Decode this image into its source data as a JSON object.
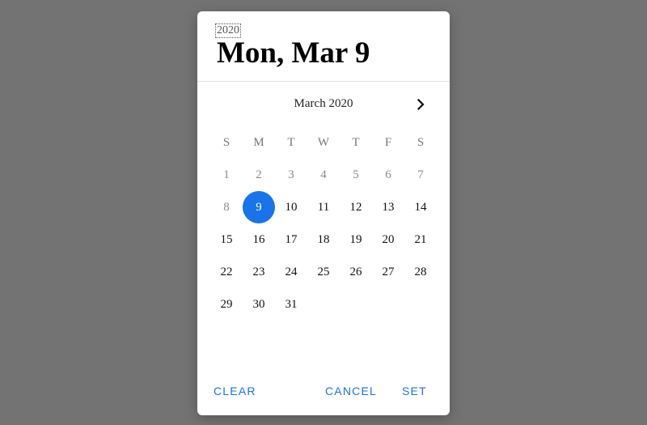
{
  "dialog": {
    "year": "2020",
    "selected_date_title": "Mon, Mar 9",
    "month_label": "March 2020",
    "next_month_icon": "chevron-right-icon"
  },
  "weekdays": [
    "S",
    "M",
    "T",
    "W",
    "T",
    "F",
    "S"
  ],
  "weeks": [
    [
      "1",
      "2",
      "3",
      "4",
      "5",
      "6",
      "7"
    ],
    [
      "8",
      "9",
      "10",
      "11",
      "12",
      "13",
      "14"
    ],
    [
      "15",
      "16",
      "17",
      "18",
      "19",
      "20",
      "21"
    ],
    [
      "22",
      "23",
      "24",
      "25",
      "26",
      "27",
      "28"
    ],
    [
      "29",
      "30",
      "31",
      "",
      "",
      "",
      ""
    ]
  ],
  "disabled_days": [
    "1",
    "2",
    "3",
    "4",
    "5",
    "6",
    "7",
    "8"
  ],
  "selected_day": "9",
  "actions": {
    "clear_label": "CLEAR",
    "cancel_label": "CANCEL",
    "set_label": "SET"
  },
  "colors": {
    "accent": "#1a73e8",
    "backdrop": "#737373"
  }
}
